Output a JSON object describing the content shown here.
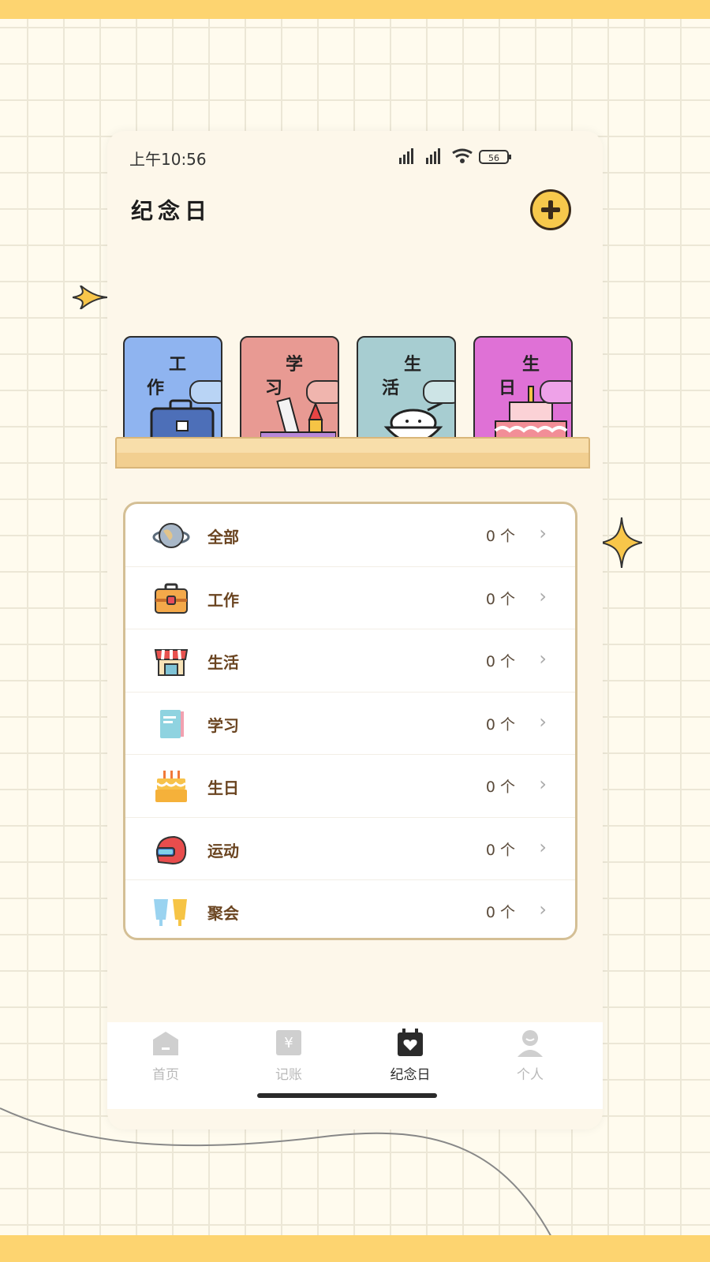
{
  "status": {
    "time": "上午10:56",
    "battery": "56"
  },
  "header": {
    "title": "纪念日",
    "add_icon": "plus-icon"
  },
  "books": [
    {
      "ch1": "工",
      "ch2": "作",
      "color": "#8fb4f0",
      "art": "briefcase"
    },
    {
      "ch1": "学",
      "ch2": "习",
      "color": "#e89a93",
      "art": "ruler-pencil"
    },
    {
      "ch1": "生",
      "ch2": "活",
      "color": "#a7cdd1",
      "art": "rice-bowl"
    },
    {
      "ch1": "生",
      "ch2": "日",
      "color": "#df71d6",
      "art": "cake"
    }
  ],
  "categories": [
    {
      "label": "全部",
      "count": "0 个",
      "icon": "globe-icon"
    },
    {
      "label": "工作",
      "count": "0 个",
      "icon": "toolbox-icon"
    },
    {
      "label": "生活",
      "count": "0 个",
      "icon": "shop-icon"
    },
    {
      "label": "学习",
      "count": "0 个",
      "icon": "book-icon"
    },
    {
      "label": "生日",
      "count": "0 个",
      "icon": "cake-icon"
    },
    {
      "label": "运动",
      "count": "0 个",
      "icon": "helmet-icon"
    },
    {
      "label": "聚会",
      "count": "0 个",
      "icon": "drinks-icon"
    }
  ],
  "chevron": "›",
  "tabs": [
    {
      "label": "首页",
      "icon": "home-icon"
    },
    {
      "label": "记账",
      "icon": "yen-note-icon"
    },
    {
      "label": "纪念日",
      "icon": "calendar-heart-icon"
    },
    {
      "label": "个人",
      "icon": "person-icon"
    }
  ],
  "colors": {
    "accent": "#f7c84c",
    "brand_bar": "#fdd470",
    "text_brown": "#6a4420"
  }
}
